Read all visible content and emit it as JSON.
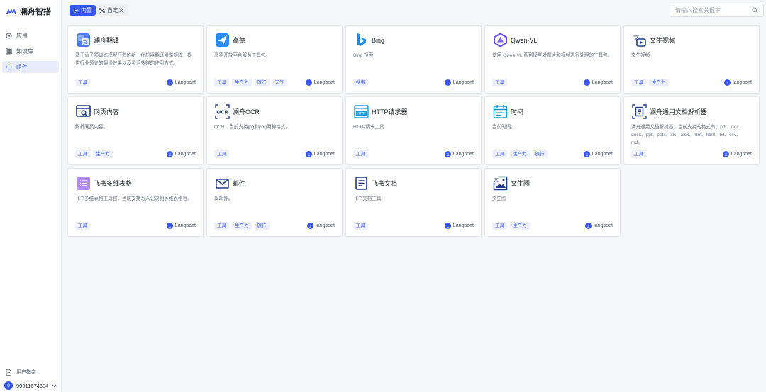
{
  "app": {
    "title": "澜舟智搭"
  },
  "sidebar": {
    "items": [
      {
        "label": "应用",
        "icon": "app-icon",
        "active": false
      },
      {
        "label": "知识库",
        "icon": "book-icon",
        "active": false
      },
      {
        "label": "组件",
        "icon": "component-icon",
        "active": true
      }
    ],
    "guide_label": "用户指南",
    "user": {
      "initial": "9",
      "name": "99911674634"
    }
  },
  "tabs": [
    {
      "label": "内置",
      "active": true,
      "icon": "builtin-icon"
    },
    {
      "label": "自定义",
      "active": false,
      "icon": "custom-icon"
    }
  ],
  "search": {
    "placeholder": "请输入搜索关键字"
  },
  "colors": {
    "accent": "#3355f0",
    "tag_bg": "#eef1fd"
  },
  "cards": [
    {
      "title": "澜舟翻译",
      "desc": "基于孟子预训练模型打造的新一代机器翻译引擎矩阵，提供行业领先的翻译效果以及灵活多样的使用方式。",
      "tags": [
        "工具"
      ],
      "author": "Langboat",
      "icon": "translate-icon"
    },
    {
      "title": "高德",
      "desc": "高德开放平台服务工具包。",
      "tags": [
        "工具",
        "生产力",
        "旅行",
        "天气"
      ],
      "author": "Langboat",
      "icon": "amap-icon"
    },
    {
      "title": "Bing",
      "desc": "Bing 搜索",
      "tags": [
        "搜索"
      ],
      "author": "Langboat",
      "icon": "bing-icon"
    },
    {
      "title": "Qwen-VL",
      "desc": "使用 Qwen-VL 系列模型对图片和视频进行处理的工具包。",
      "tags": [
        "工具"
      ],
      "author": "Langboat",
      "icon": "qwen-icon"
    },
    {
      "title": "文生视频",
      "desc": "文生视频",
      "tags": [
        "工具",
        "生产力"
      ],
      "author": "langboat",
      "icon": "text-to-video-icon"
    },
    {
      "title": "网页内容",
      "desc": "解析网页内容。",
      "tags": [
        "工具",
        "生产力"
      ],
      "author": "Langboat",
      "icon": "webpage-icon"
    },
    {
      "title": "澜舟OCR",
      "desc": "OCR，当前支持jpg和png两种格式。",
      "tags": [
        "工具"
      ],
      "author": "Langboat",
      "icon": "ocr-icon"
    },
    {
      "title": "HTTP请求器",
      "desc": "HTTP请求工具",
      "tags": [
        "工具"
      ],
      "author": "Langboat",
      "icon": "http-icon"
    },
    {
      "title": "时间",
      "desc": "当前时间。",
      "tags": [
        "工具",
        "生产力",
        "旅行"
      ],
      "author": "Langboat",
      "icon": "calendar-icon"
    },
    {
      "title": "澜舟通用文档解析器",
      "desc": "澜舟通用文档解析器，当前支持的格式有：pdf、doc、docx、ppt、pptx、xls、xlsx、htm、html、txt、csv、md。",
      "tags": [
        "工具"
      ],
      "author": "Langboat",
      "icon": "doc-parser-icon"
    },
    {
      "title": "飞书多维表格",
      "desc": "飞书多维表格工具包，当前支持写入记录到多维表格等。",
      "tags": [
        "工具"
      ],
      "author": "Langboat",
      "icon": "feishu-table-icon"
    },
    {
      "title": "邮件",
      "desc": "发邮件。",
      "tags": [
        "工具",
        "生产力",
        "旅行"
      ],
      "author": "langboat",
      "icon": "mail-icon"
    },
    {
      "title": "飞书文档",
      "desc": "飞书文档工具",
      "tags": [
        "工具"
      ],
      "author": "Langboat",
      "icon": "feishu-doc-icon"
    },
    {
      "title": "文生图",
      "desc": "文生图",
      "tags": [
        "工具",
        "生产力"
      ],
      "author": "langboat",
      "icon": "text-to-image-icon"
    }
  ]
}
